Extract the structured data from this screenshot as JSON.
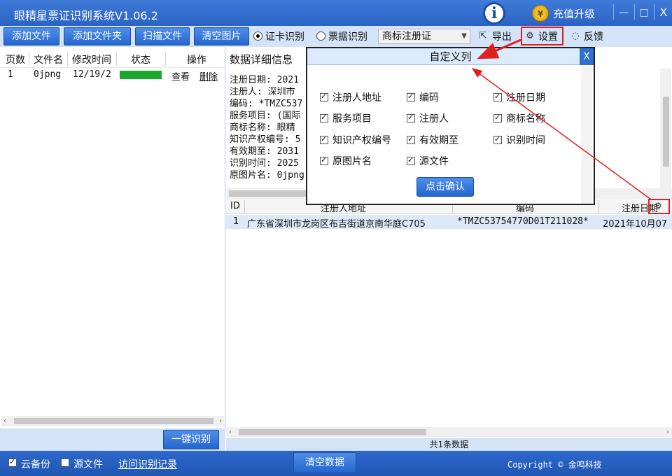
{
  "window": {
    "title": "眼精星票证识别系统V1.06.2",
    "recharge": "充值升级",
    "coin_symbol": "¥",
    "info_symbol": "i",
    "minimize": "—",
    "maximize": "□",
    "close": "X"
  },
  "toolbar": {
    "add_file": "添加文件",
    "add_folder": "添加文件夹",
    "scan_file": "扫描文件",
    "clear_images": "清空图片",
    "mode_card": "证卡识别",
    "mode_bill": "票据识别",
    "selected_mode": "证卡识别",
    "doc_type": "商标注册证",
    "export": "导出",
    "settings": "设置",
    "feedback": "反馈"
  },
  "file_list": {
    "headers": [
      "页数",
      "文件名",
      "修改时间",
      "状态",
      "操作"
    ],
    "rows": [
      {
        "page": "1",
        "name": "0jpng",
        "time": "12/19/2",
        "view": "查看",
        "delete": "删除",
        "progress": 1.0
      }
    ],
    "recognize_all": "一键识别"
  },
  "detail": {
    "title": "数据详细信息",
    "lines": [
      "注册日期: 2021",
      "注册人: 深圳市",
      "编码: *TMZC537",
      "服务项目: (国际",
      "商标名称: 眼精",
      "知识产权编号: 5",
      "有效期至: 2031",
      "识别时间: 2025",
      "原图片名: 0jpng"
    ]
  },
  "grid": {
    "headers": [
      "ID",
      "注册人地址",
      "编码",
      "注册日期"
    ],
    "rows": [
      [
        "1",
        "广东省深圳市龙岗区布吉街道京南华庭C705",
        "*TMZC53754770D01T211028*",
        "2021年10月07"
      ]
    ],
    "summary": "共1条数据"
  },
  "dialog": {
    "title": "自定义列",
    "close": "X",
    "options": [
      {
        "label": "注册人地址",
        "checked": true
      },
      {
        "label": "编码",
        "checked": true
      },
      {
        "label": "注册日期",
        "checked": true
      },
      {
        "label": "服务项目",
        "checked": true
      },
      {
        "label": "注册人",
        "checked": true
      },
      {
        "label": "商标名称",
        "checked": true
      },
      {
        "label": "知识产权编号",
        "checked": true
      },
      {
        "label": "有效期至",
        "checked": true
      },
      {
        "label": "识别时间",
        "checked": true
      },
      {
        "label": "原图片名",
        "checked": true
      },
      {
        "label": "源文件",
        "checked": true
      }
    ],
    "confirm": "点击确认"
  },
  "footer": {
    "cloud_backup": "云备份",
    "cloud_backup_checked": true,
    "source_file": "源文件",
    "source_file_checked": false,
    "history": "访问识别记录",
    "clear_data": "清空数据",
    "copyright": "Copyright © 金鸣科技"
  },
  "colors": {
    "accent": "#2a63c4",
    "progress": "#19a82d",
    "highlight": "#e02020"
  }
}
